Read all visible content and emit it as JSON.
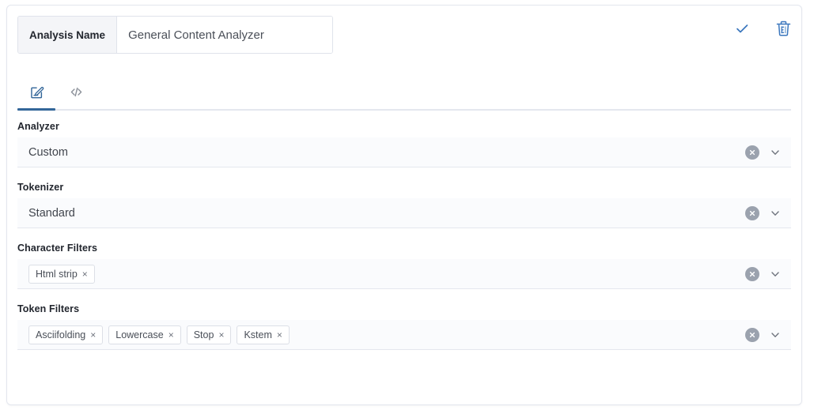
{
  "header": {
    "name_label": "Analysis Name",
    "name_value": "General Content Analyzer",
    "save_title": "Save",
    "delete_title": "Delete",
    "accent_color": "#336699",
    "check_icon": "check-icon",
    "trash_icon": "trash-icon"
  },
  "tabs": [
    {
      "id": "visual",
      "icon": "edit-document-icon",
      "label": "Visual editor",
      "active": true
    },
    {
      "id": "code",
      "icon": "code-brackets-icon",
      "label": "Code editor",
      "active": false
    }
  ],
  "fields": [
    {
      "id": "analyzer",
      "label": "Analyzer",
      "type": "select",
      "value": "Custom",
      "clear_icon": "clear-circle-icon",
      "caret_icon": "chevron-down-icon"
    },
    {
      "id": "tokenizer",
      "label": "Tokenizer",
      "type": "select",
      "value": "Standard",
      "clear_icon": "clear-circle-icon",
      "caret_icon": "chevron-down-icon"
    },
    {
      "id": "character_filters",
      "label": "Character Filters",
      "type": "multiselect",
      "chips": [
        "Html strip"
      ],
      "chip_remove": "×",
      "clear_icon": "clear-circle-icon",
      "caret_icon": "chevron-down-icon"
    },
    {
      "id": "token_filters",
      "label": "Token Filters",
      "type": "multiselect",
      "chips": [
        "Asciifolding",
        "Lowercase",
        "Stop",
        "Kstem"
      ],
      "chip_remove": "×",
      "clear_icon": "clear-circle-icon",
      "caret_icon": "chevron-down-icon"
    }
  ]
}
